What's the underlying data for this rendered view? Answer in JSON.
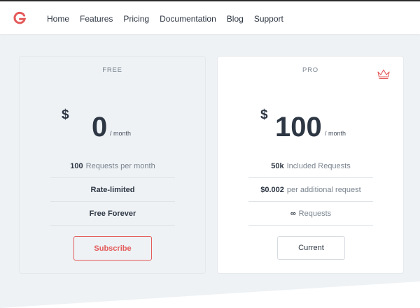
{
  "nav": {
    "logo_icon": "g-logo-icon",
    "items": [
      "Home",
      "Features",
      "Pricing",
      "Documentation",
      "Blog",
      "Support"
    ]
  },
  "plans": {
    "free": {
      "name": "FREE",
      "currency": "$",
      "amount": "0",
      "period": "/ month",
      "features": [
        {
          "bold": "100",
          "text": "Requests per month"
        },
        {
          "bold": "Rate-limited",
          "text": ""
        },
        {
          "bold": "Free Forever",
          "text": ""
        }
      ],
      "button": "Subscribe"
    },
    "pro": {
      "name": "PRO",
      "badge_icon": "crown-icon",
      "currency": "$",
      "amount": "100",
      "period": "/ month",
      "features": [
        {
          "bold": "50k",
          "text": "Included Requests"
        },
        {
          "bold": "$0.002",
          "text": "per additional request"
        },
        {
          "bold": "∞",
          "text": "Requests"
        }
      ],
      "button": "Current"
    }
  },
  "colors": {
    "accent": "#e45a5a",
    "text": "#2d3643",
    "muted": "#7b8590",
    "background": "#eef2f5"
  }
}
